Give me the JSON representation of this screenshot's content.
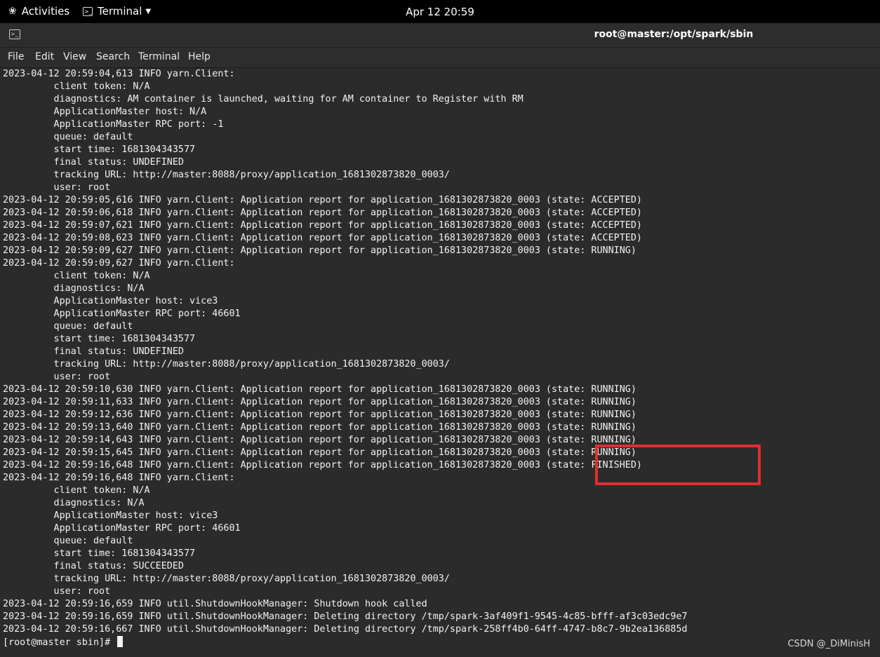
{
  "topbar": {
    "activities_label": "Activities",
    "app_label": "Terminal",
    "clock": "Apr 12  20:59"
  },
  "window": {
    "title": "root@master:/opt/spark/sbin"
  },
  "menu": [
    "File",
    "Edit",
    "View",
    "Search",
    "Terminal",
    "Help"
  ],
  "terminal": {
    "lines": [
      "2023-04-12 20:59:04,613 INFO yarn.Client:",
      "\t client token: N/A",
      "\t diagnostics: AM container is launched, waiting for AM container to Register with RM",
      "\t ApplicationMaster host: N/A",
      "\t ApplicationMaster RPC port: -1",
      "\t queue: default",
      "\t start time: 1681304343577",
      "\t final status: UNDEFINED",
      "\t tracking URL: http://master:8088/proxy/application_1681302873820_0003/",
      "\t user: root",
      "2023-04-12 20:59:05,616 INFO yarn.Client: Application report for application_1681302873820_0003 (state: ACCEPTED)",
      "2023-04-12 20:59:06,618 INFO yarn.Client: Application report for application_1681302873820_0003 (state: ACCEPTED)",
      "2023-04-12 20:59:07,621 INFO yarn.Client: Application report for application_1681302873820_0003 (state: ACCEPTED)",
      "2023-04-12 20:59:08,623 INFO yarn.Client: Application report for application_1681302873820_0003 (state: ACCEPTED)",
      "2023-04-12 20:59:09,627 INFO yarn.Client: Application report for application_1681302873820_0003 (state: RUNNING)",
      "2023-04-12 20:59:09,627 INFO yarn.Client:",
      "\t client token: N/A",
      "\t diagnostics: N/A",
      "\t ApplicationMaster host: vice3",
      "\t ApplicationMaster RPC port: 46601",
      "\t queue: default",
      "\t start time: 1681304343577",
      "\t final status: UNDEFINED",
      "\t tracking URL: http://master:8088/proxy/application_1681302873820_0003/",
      "\t user: root",
      "2023-04-12 20:59:10,630 INFO yarn.Client: Application report for application_1681302873820_0003 (state: RUNNING)",
      "2023-04-12 20:59:11,633 INFO yarn.Client: Application report for application_1681302873820_0003 (state: RUNNING)",
      "2023-04-12 20:59:12,636 INFO yarn.Client: Application report for application_1681302873820_0003 (state: RUNNING)",
      "2023-04-12 20:59:13,640 INFO yarn.Client: Application report for application_1681302873820_0003 (state: RUNNING)",
      "2023-04-12 20:59:14,643 INFO yarn.Client: Application report for application_1681302873820_0003 (state: RUNNING)",
      "2023-04-12 20:59:15,645 INFO yarn.Client: Application report for application_1681302873820_0003 (state: RUNNING)",
      "2023-04-12 20:59:16,648 INFO yarn.Client: Application report for application_1681302873820_0003 (state: FINISHED)",
      "2023-04-12 20:59:16,648 INFO yarn.Client:",
      "\t client token: N/A",
      "\t diagnostics: N/A",
      "\t ApplicationMaster host: vice3",
      "\t ApplicationMaster RPC port: 46601",
      "\t queue: default",
      "\t start time: 1681304343577",
      "\t final status: SUCCEEDED",
      "\t tracking URL: http://master:8088/proxy/application_1681302873820_0003/",
      "\t user: root",
      "2023-04-12 20:59:16,659 INFO util.ShutdownHookManager: Shutdown hook called",
      "2023-04-12 20:59:16,659 INFO util.ShutdownHookManager: Deleting directory /tmp/spark-3af409f1-9545-4c85-bfff-af3c03edc9e7",
      "2023-04-12 20:59:16,667 INFO util.ShutdownHookManager: Deleting directory /tmp/spark-258ff4b0-64ff-4747-b8c7-9b2ea136885d"
    ],
    "prompt": "[root@master sbin]# "
  },
  "watermark": "CSDN @_DiMinisH",
  "colors": {
    "terminal_bg": "#2b2b2b",
    "terminal_fg": "#f2f2f2",
    "highlight": "#e32d2d"
  }
}
